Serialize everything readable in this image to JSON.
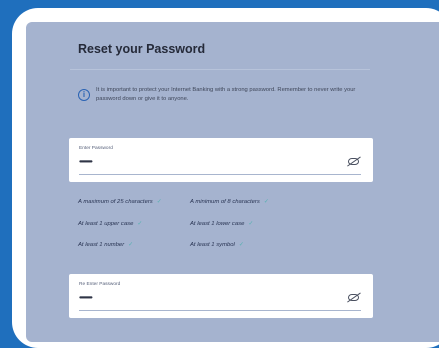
{
  "form": {
    "title": "Reset your Password",
    "info": "It is important to protect your Internet Banking with a strong password. Remember to never write your password down or give it to anyone.",
    "password": {
      "label": "Enter Password",
      "value": "••••••••••••"
    },
    "confirm": {
      "label": "Re Enter Password",
      "value": "••••••••••••"
    },
    "rules": [
      "A maximum of 25 characters",
      "A minimum of 8 characters",
      "At least 1 upper case",
      "At least 1 lower case",
      "At least 1 number",
      "At least 1 symbol"
    ],
    "check_glyph": "✓"
  }
}
